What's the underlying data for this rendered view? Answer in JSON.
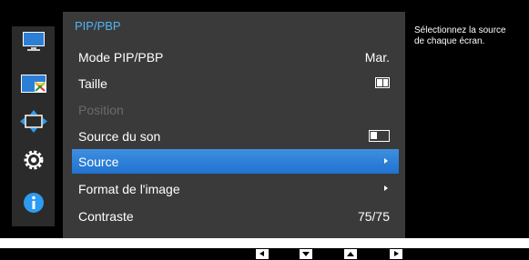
{
  "colors": {
    "accent": "#54b4f5",
    "selected_item": "#2a7dd8",
    "panel_bg": "#3a3a3a",
    "osd_bg": "#000000",
    "disabled_text": "#6a6a6a"
  },
  "sidebar": {
    "items": [
      {
        "icon": "picture-icon"
      },
      {
        "icon": "pip-pbp-icon"
      },
      {
        "icon": "onscreen-display-icon"
      },
      {
        "icon": "gear-icon"
      },
      {
        "icon": "info-icon"
      }
    ]
  },
  "menu": {
    "title": "PIP/PBP",
    "items": [
      {
        "label": "Mode PIP/PBP",
        "value": "Mar."
      },
      {
        "label": "Taille",
        "value_icon": "pbp-size-icon"
      },
      {
        "label": "Position",
        "disabled": true
      },
      {
        "label": "Source du son",
        "value_icon": "sound-source-icon"
      },
      {
        "label": "Source",
        "selected": true,
        "value_icon": "submenu-arrow-icon"
      },
      {
        "label": "Format de l'image",
        "value_icon": "submenu-arrow-icon"
      },
      {
        "label": "Contraste",
        "value": "75/75"
      }
    ]
  },
  "help": {
    "text": "Sélectionnez la source de chaque écran."
  },
  "nav_buttons": [
    {
      "icon": "left-arrow-icon"
    },
    {
      "icon": "down-arrow-icon"
    },
    {
      "icon": "up-arrow-icon"
    },
    {
      "icon": "right-arrow-icon"
    }
  ]
}
